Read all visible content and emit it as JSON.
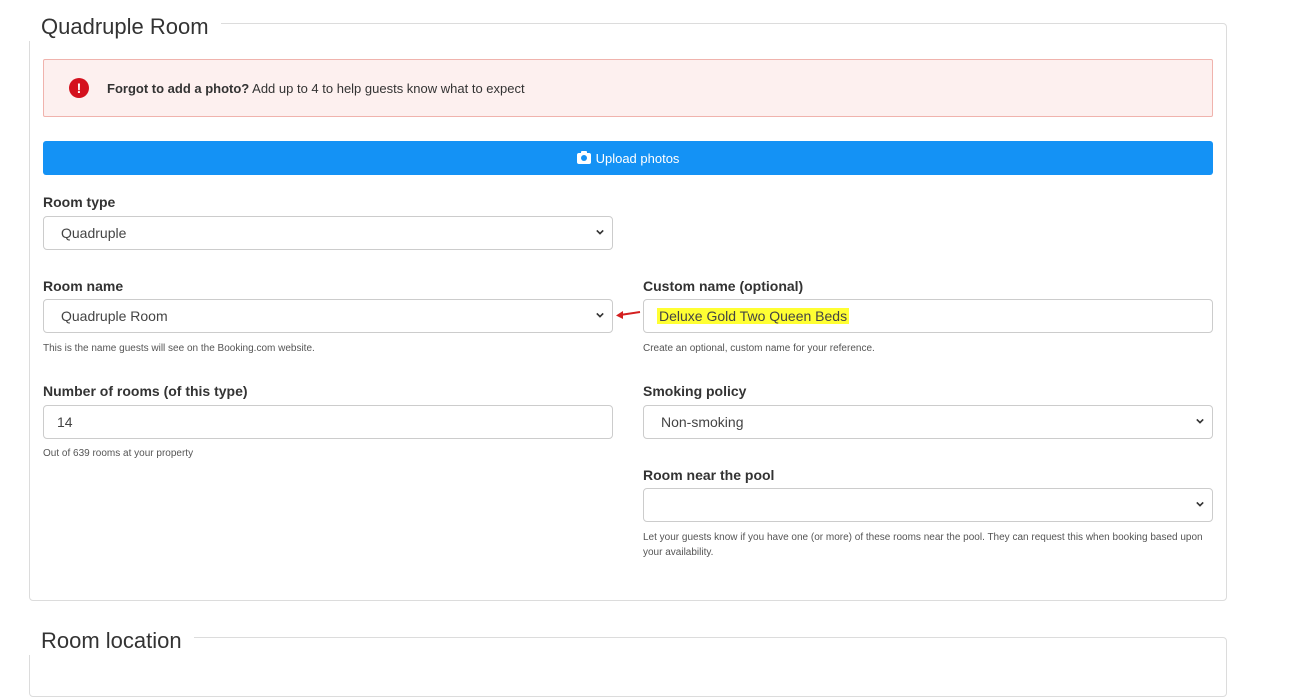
{
  "section1": {
    "legend": "Quadruple Room"
  },
  "alert": {
    "icon": "exclamation-icon",
    "bold": "Forgot to add a photo?",
    "text": " Add up to 4 to help guests know what to expect"
  },
  "upload": {
    "icon": "camera-icon",
    "label": "Upload photos"
  },
  "room_type": {
    "label": "Room type",
    "value": "Quadruple"
  },
  "room_name": {
    "label": "Room name",
    "value": "Quadruple Room",
    "help": "This is the name guests will see on the Booking.com website."
  },
  "custom_name": {
    "label": "Custom name (optional)",
    "value": "Deluxe Gold Two Queen Beds",
    "help": "Create an optional, custom name for your reference."
  },
  "num_rooms": {
    "label": "Number of rooms (of this type)",
    "value": "14",
    "help": "Out of 639 rooms at your property"
  },
  "smoking": {
    "label": "Smoking policy",
    "value": "Non-smoking"
  },
  "pool": {
    "label": "Room near the pool",
    "value": "",
    "help": "Let your guests know if you have one (or more) of these rooms near the pool. They can request this when booking based upon your availability."
  },
  "section2": {
    "legend": "Room location"
  },
  "colors": {
    "upload_bg": "#1492f5",
    "alert_bg": "#fdf0ef",
    "alert_icon": "#d4111e",
    "highlight": "#ffff33",
    "annotation_arrow": "#d42020"
  }
}
